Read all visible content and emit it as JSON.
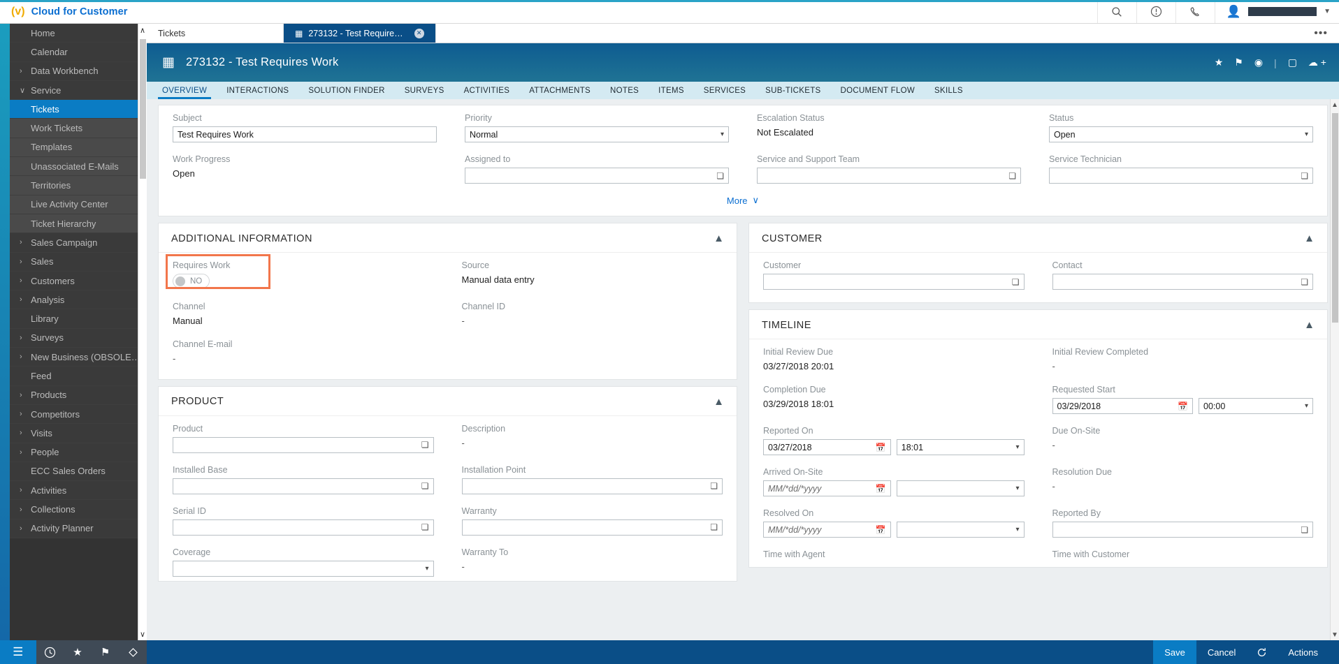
{
  "topbar": {
    "brand_logo": "(v)",
    "brand_name": "Cloud for Customer",
    "icons": {
      "search": "search-icon",
      "help": "help-icon",
      "phone": "phone-icon",
      "avatar": "user-avatar"
    }
  },
  "sidebar": {
    "items": [
      {
        "label": "Home",
        "expandable": false,
        "sub": false,
        "active": false
      },
      {
        "label": "Calendar",
        "expandable": false,
        "sub": false,
        "active": false
      },
      {
        "label": "Data Workbench",
        "expandable": true,
        "chev": "›",
        "sub": false,
        "active": false
      },
      {
        "label": "Service",
        "expandable": true,
        "chev": "∨",
        "sub": false,
        "active": false
      },
      {
        "label": "Tickets",
        "expandable": false,
        "sub": true,
        "active": true
      },
      {
        "label": "Work Tickets",
        "expandable": false,
        "sub": true,
        "active": false
      },
      {
        "label": "Templates",
        "expandable": false,
        "sub": true,
        "active": false
      },
      {
        "label": "Unassociated E-Mails",
        "expandable": false,
        "sub": true,
        "active": false
      },
      {
        "label": "Territories",
        "expandable": false,
        "sub": true,
        "active": false
      },
      {
        "label": "Live Activity Center",
        "expandable": false,
        "sub": true,
        "active": false
      },
      {
        "label": "Ticket Hierarchy",
        "expandable": false,
        "sub": true,
        "active": false
      },
      {
        "label": "Sales Campaign",
        "expandable": true,
        "chev": "›",
        "sub": false,
        "active": false
      },
      {
        "label": "Sales",
        "expandable": true,
        "chev": "›",
        "sub": false,
        "active": false
      },
      {
        "label": "Customers",
        "expandable": true,
        "chev": "›",
        "sub": false,
        "active": false
      },
      {
        "label": "Analysis",
        "expandable": true,
        "chev": "›",
        "sub": false,
        "active": false
      },
      {
        "label": "Library",
        "expandable": false,
        "sub": false,
        "active": false
      },
      {
        "label": "Surveys",
        "expandable": true,
        "chev": "›",
        "sub": false,
        "active": false
      },
      {
        "label": "New Business (OBSOLE…",
        "expandable": true,
        "chev": "›",
        "sub": false,
        "active": false
      },
      {
        "label": "Feed",
        "expandable": false,
        "sub": false,
        "active": false
      },
      {
        "label": "Products",
        "expandable": true,
        "chev": "›",
        "sub": false,
        "active": false
      },
      {
        "label": "Competitors",
        "expandable": true,
        "chev": "›",
        "sub": false,
        "active": false
      },
      {
        "label": "Visits",
        "expandable": true,
        "chev": "›",
        "sub": false,
        "active": false
      },
      {
        "label": "People",
        "expandable": true,
        "chev": "›",
        "sub": false,
        "active": false
      },
      {
        "label": "ECC Sales Orders",
        "expandable": false,
        "sub": false,
        "active": false
      },
      {
        "label": "Activities",
        "expandable": true,
        "chev": "›",
        "sub": false,
        "active": false
      },
      {
        "label": "Collections",
        "expandable": true,
        "chev": "›",
        "sub": false,
        "active": false
      },
      {
        "label": "Activity Planner",
        "expandable": true,
        "chev": "›",
        "sub": false,
        "active": false
      }
    ],
    "footer_icons": [
      "menu-icon",
      "recent-icon",
      "favorites-icon",
      "flag-icon",
      "tag-icon"
    ],
    "scroll_up": "∧",
    "scroll_down": "∨"
  },
  "worktabs": {
    "tabs": [
      {
        "label": "Tickets",
        "active": false,
        "closable": false
      },
      {
        "label": "273132 - Test Require…",
        "active": true,
        "closable": true
      }
    ],
    "close_glyph": "✕",
    "overflow": "•••"
  },
  "doc_header": {
    "icon": "ticket-icon",
    "title": "273132 - Test Requires Work",
    "actions": [
      "★",
      "⚑",
      "◉",
      "|",
      "▢",
      "☁ +"
    ]
  },
  "nav_tabs": [
    {
      "label": "OVERVIEW",
      "active": true
    },
    {
      "label": "INTERACTIONS",
      "active": false
    },
    {
      "label": "SOLUTION FINDER",
      "active": false
    },
    {
      "label": "SURVEYS",
      "active": false
    },
    {
      "label": "ACTIVITIES",
      "active": false
    },
    {
      "label": "ATTACHMENTS",
      "active": false
    },
    {
      "label": "NOTES",
      "active": false
    },
    {
      "label": "ITEMS",
      "active": false
    },
    {
      "label": "SERVICES",
      "active": false
    },
    {
      "label": "SUB-TICKETS",
      "active": false
    },
    {
      "label": "DOCUMENT FLOW",
      "active": false
    },
    {
      "label": "SKILLS",
      "active": false
    }
  ],
  "summary": {
    "subject": {
      "label": "Subject",
      "value": "Test Requires Work"
    },
    "priority": {
      "label": "Priority",
      "value": "Normal"
    },
    "escalation_status": {
      "label": "Escalation Status",
      "value": "Not Escalated"
    },
    "status": {
      "label": "Status",
      "value": "Open"
    },
    "work_progress": {
      "label": "Work Progress",
      "value": "Open"
    },
    "assigned_to": {
      "label": "Assigned to",
      "value": ""
    },
    "service_support_team": {
      "label": "Service and Support Team",
      "value": ""
    },
    "service_technician": {
      "label": "Service Technician",
      "value": ""
    },
    "more_label": "More",
    "more_chev": "∨"
  },
  "additional_information": {
    "title": "ADDITIONAL INFORMATION",
    "requires_work": {
      "label": "Requires Work",
      "value": "NO",
      "highlighted": true
    },
    "source": {
      "label": "Source",
      "value": "Manual data entry"
    },
    "channel": {
      "label": "Channel",
      "value": "Manual"
    },
    "channel_id": {
      "label": "Channel ID",
      "value": "-"
    },
    "channel_email": {
      "label": "Channel E-mail",
      "value": "-"
    }
  },
  "product": {
    "title": "PRODUCT",
    "product": {
      "label": "Product",
      "value": ""
    },
    "description": {
      "label": "Description",
      "value": "-"
    },
    "installed_base": {
      "label": "Installed Base",
      "value": ""
    },
    "installation_point": {
      "label": "Installation Point",
      "value": ""
    },
    "serial_id": {
      "label": "Serial ID",
      "value": ""
    },
    "warranty": {
      "label": "Warranty",
      "value": ""
    },
    "coverage": {
      "label": "Coverage",
      "value": ""
    },
    "warranty_to": {
      "label": "Warranty To",
      "value": "-"
    }
  },
  "customer": {
    "title": "CUSTOMER",
    "customer": {
      "label": "Customer",
      "value": ""
    },
    "contact": {
      "label": "Contact",
      "value": ""
    }
  },
  "timeline": {
    "title": "TIMELINE",
    "initial_review_due": {
      "label": "Initial Review Due",
      "value": "03/27/2018 20:01"
    },
    "initial_review_completed": {
      "label": "Initial Review Completed",
      "value": "-"
    },
    "completion_due": {
      "label": "Completion Due",
      "value": "03/29/2018 18:01"
    },
    "requested_start": {
      "label": "Requested Start",
      "date": "03/29/2018",
      "time": "00:00"
    },
    "reported_on": {
      "label": "Reported On",
      "date": "03/27/2018",
      "time": "18:01"
    },
    "due_on_site": {
      "label": "Due On-Site",
      "value": "-"
    },
    "arrived_on_site": {
      "label": "Arrived On-Site",
      "date_placeholder": "MM/*dd/*yyyy",
      "time": ""
    },
    "resolution_due": {
      "label": "Resolution Due",
      "value": "-"
    },
    "resolved_on": {
      "label": "Resolved On",
      "date_placeholder": "MM/*dd/*yyyy",
      "time": ""
    },
    "reported_by": {
      "label": "Reported By",
      "value": ""
    },
    "time_with_agent": {
      "label": "Time with Agent",
      "value": ""
    },
    "time_with_customer": {
      "label": "Time with Customer",
      "value": ""
    }
  },
  "actionbar": {
    "save": "Save",
    "cancel": "Cancel",
    "refresh_icon": "refresh-icon",
    "actions": "Actions"
  },
  "colors": {
    "brand_blue": "#0a6ed1",
    "header_blue": "#0a4e87",
    "accent_blue": "#0a7cc4",
    "highlight_orange": "#f2764b",
    "tabnav_bg": "#d4eaf2"
  }
}
